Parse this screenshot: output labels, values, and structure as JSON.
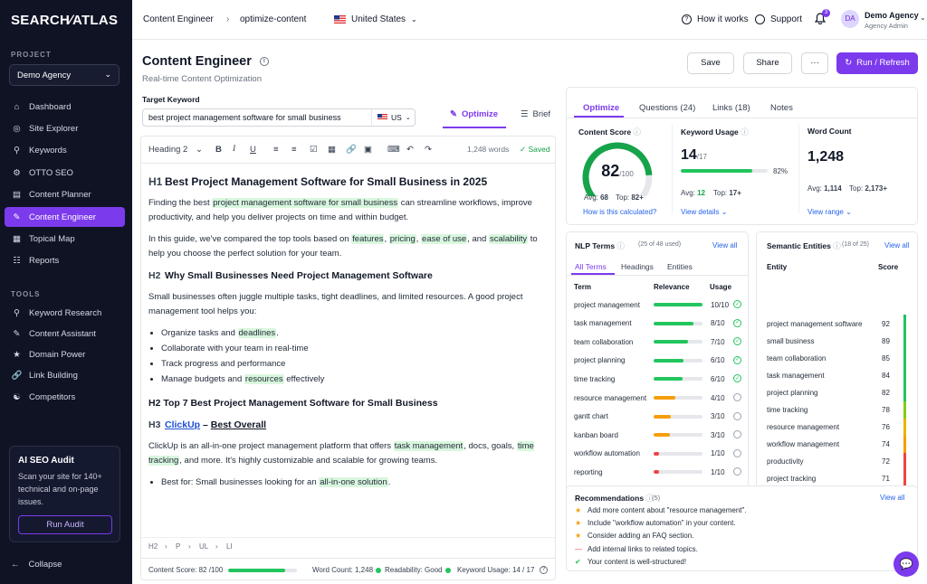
{
  "app": {
    "logo": "SEARCH∕ATLAS"
  },
  "sidebar": {
    "project_section": "PROJECT",
    "project": "Demo Agency",
    "nav": [
      {
        "label": "Dashboard"
      },
      {
        "label": "Site Explorer"
      },
      {
        "label": "Keywords"
      },
      {
        "label": "OTTO SEO"
      },
      {
        "label": "Content Planner"
      },
      {
        "label": "Content Engineer"
      },
      {
        "label": "Topical Map"
      },
      {
        "label": "Reports"
      }
    ],
    "tools_section": "TOOLS",
    "tools": [
      {
        "label": "Keyword Research"
      },
      {
        "label": "Content Assistant"
      },
      {
        "label": "Domain Power"
      },
      {
        "label": "Link Building"
      },
      {
        "label": "Competitors"
      }
    ],
    "audit": {
      "title": "AI SEO Audit",
      "desc": "Scan your site for 140+ technical and on-page issues.",
      "button": "Run Audit"
    },
    "collapse": "Collapse"
  },
  "topbar": {
    "crumb1": "Content Engineer",
    "sep": "›",
    "crumb2": "optimize-content",
    "country": "United States",
    "how": "How it works",
    "support": "Support",
    "notif": "3",
    "avatar": "DA",
    "user": "Demo Agency",
    "role": "Agency Admin"
  },
  "header": {
    "title": "Content Engineer",
    "subtitle": "Real-time Content Optimization",
    "save": "Save",
    "share": "Share",
    "more": "···",
    "run": "Run / Refresh"
  },
  "keyword": {
    "label": "Target Keyword",
    "value": "best project management software for small business",
    "country": "US",
    "tab_optimize": "Optimize",
    "tab_brief": "Brief"
  },
  "editor": {
    "heading_select": "Heading 2",
    "words": "1,248 words",
    "saved": "Saved",
    "h1_tag": "H1",
    "h1": "Best Project Management Software for Small Business in 2025",
    "p1a": "Finding the best ",
    "p1hl": "project management software for small business",
    "p1b": " can streamline workflows, improve productivity, and help you deliver projects on time and within budget.",
    "p2a": "In this guide, we've compared the top tools based on ",
    "p2h1": "features",
    "p2h2": "pricing",
    "p2h3": "ease of use",
    "p2b": ", and ",
    "p2h4": "scalability",
    "p2c": " to help you choose the perfect solution for your team.",
    "h2_tag": "H2",
    "h2": "Why Small Businesses Need Project Management Software",
    "p3": "Small businesses often juggle multiple tasks, tight deadlines, and limited resources. A good project management tool helps you:",
    "b1a": "Organize tasks and ",
    "b1h": "deadlines",
    "b1b": ".",
    "b2": "Collaborate with your team in real-time",
    "b3": "Track progress and performance",
    "b4a": "Manage budgets and ",
    "b4h": "resources",
    "b4b": " effectively",
    "h2b": "H2 Top 7 Best Project Management Software for Small Business",
    "h3_tag": "H3",
    "h3link": "ClickUp",
    "h3rest": " – ",
    "h3b": "Best Overall",
    "p4a": "ClickUp is an all-in-one project management platform that offers ",
    "p4h1": "task management",
    "p4b": ", docs, goals, ",
    "p4h2": "time tracking",
    "p4c": ", and more. It's highly customizable and scalable for growing teams.",
    "b5a": "Best for: Small businesses looking for an ",
    "b5h": "all-in-one solution",
    "b5b": ".",
    "footer_path": [
      "H2",
      "›",
      "P",
      "›",
      "UL",
      "›",
      "LI"
    ],
    "status": {
      "score_label": "Content Score:",
      "score": "82 /100",
      "score_pct": 82,
      "wc_label": "Word Count:",
      "wc": "1,248",
      "read_label": "Readability:",
      "read": "Good",
      "kw_label": "Keyword Usage:",
      "kw": "14 / 17"
    }
  },
  "right": {
    "tabs": [
      "Optimize",
      "Questions (24)",
      "Links (18)",
      "Notes"
    ],
    "score": {
      "label": "Content Score",
      "value": "82",
      "of": "/100",
      "avg_label": "Avg:",
      "avg": "68",
      "top_label": "Top:",
      "top": "82+",
      "how": "How is this calculated?",
      "pct": 82
    },
    "usage": {
      "label": "Keyword Usage",
      "value": "14",
      "of": "/17",
      "pct_text": "82%",
      "avg_label": "Avg:",
      "avg": "12",
      "top_label": "Top:",
      "top": "17+",
      "link": "View details",
      "pct": 82
    },
    "wordcount": {
      "label": "Word Count",
      "value": "1,248",
      "avg_label": "Avg:",
      "avg": "1,114",
      "top_label": "Top:",
      "top": "2,173+",
      "link": "View range"
    },
    "nlp": {
      "title": "NLP Terms",
      "count": "(25 of 48 used)",
      "view": "View all",
      "tabs": [
        "All Terms",
        "Headings",
        "Entities"
      ],
      "cols": [
        "Term",
        "Relevance",
        "Usage"
      ],
      "rows": [
        {
          "term": "project management",
          "rel": 1.0,
          "usage": "10/10",
          "done": true,
          "color": "#22c55e"
        },
        {
          "term": "task management",
          "rel": 0.82,
          "usage": "8/10",
          "done": true,
          "color": "#22c55e"
        },
        {
          "term": "team collaboration",
          "rel": 0.7,
          "usage": "7/10",
          "done": true,
          "color": "#22c55e"
        },
        {
          "term": "project planning",
          "rel": 0.62,
          "usage": "6/10",
          "done": true,
          "color": "#22c55e"
        },
        {
          "term": "time tracking",
          "rel": 0.6,
          "usage": "6/10",
          "done": true,
          "color": "#22c55e"
        },
        {
          "term": "resource management",
          "rel": 0.45,
          "usage": "4/10",
          "done": false,
          "color": "#f59e0b"
        },
        {
          "term": "gantt chart",
          "rel": 0.35,
          "usage": "3/10",
          "done": false,
          "color": "#f59e0b"
        },
        {
          "term": "kanban board",
          "rel": 0.33,
          "usage": "3/10",
          "done": false,
          "color": "#f59e0b"
        },
        {
          "term": "workflow automation",
          "rel": 0.12,
          "usage": "1/10",
          "done": false,
          "color": "#ef4444"
        },
        {
          "term": "reporting",
          "rel": 0.12,
          "usage": "1/10",
          "done": false,
          "color": "#ef4444"
        }
      ]
    },
    "semantic": {
      "title": "Semantic Entities",
      "count": "(18 of 25)",
      "view": "View all",
      "cols": [
        "Entity",
        "Score"
      ],
      "rows": [
        {
          "entity": "project management software",
          "score": "92",
          "color": "#22c55e"
        },
        {
          "entity": "small business",
          "score": "89",
          "color": "#22c55e"
        },
        {
          "entity": "team collaboration",
          "score": "85",
          "color": "#22c55e"
        },
        {
          "entity": "task management",
          "score": "84",
          "color": "#22c55e"
        },
        {
          "entity": "project planning",
          "score": "82",
          "color": "#22c55e"
        },
        {
          "entity": "time tracking",
          "score": "78",
          "color": "#84cc16"
        },
        {
          "entity": "resource management",
          "score": "76",
          "color": "#eab308"
        },
        {
          "entity": "workflow management",
          "score": "74",
          "color": "#f59e0b"
        },
        {
          "entity": "productivity",
          "score": "72",
          "color": "#ef4444"
        },
        {
          "entity": "project tracking",
          "score": "71",
          "color": "#ef4444"
        }
      ]
    },
    "recs": {
      "title": "Recommendations",
      "count": "(5)",
      "view": "View all",
      "items": [
        {
          "icon": "★",
          "color": "#f59e0b",
          "text": "Add more content about \"resource management\"."
        },
        {
          "icon": "★",
          "color": "#f59e0b",
          "text": "Include \"workflow automation\" in your content."
        },
        {
          "icon": "★",
          "color": "#f59e0b",
          "text": "Consider adding an FAQ section."
        },
        {
          "icon": "—",
          "color": "#ef4444",
          "text": "Add internal links to related topics."
        },
        {
          "icon": "✔",
          "color": "#22c55e",
          "text": "Your content is well-structured!"
        }
      ]
    }
  }
}
